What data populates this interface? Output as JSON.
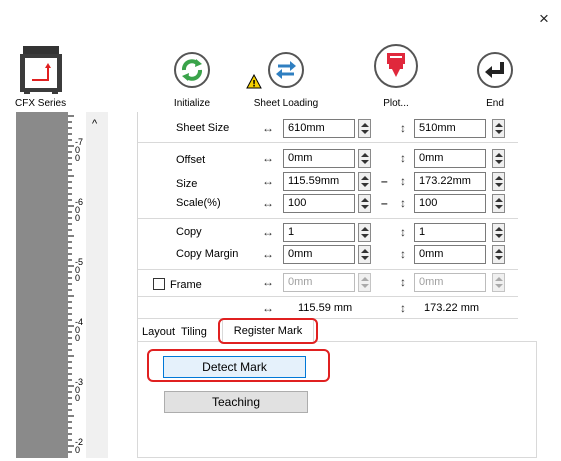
{
  "window": {
    "close_glyph": "×"
  },
  "logo": {
    "label": "CFX Series"
  },
  "toolbar": [
    {
      "label": "Initialize",
      "icon": "refresh-icon"
    },
    {
      "label": "Sheet Loading",
      "icon": "swap-arrows-icon",
      "warning": "!"
    },
    {
      "label": "Plot...",
      "icon": "plotter-cutter-icon"
    },
    {
      "label": "End",
      "icon": "return-arrow-icon"
    }
  ],
  "ruler": {
    "scroll_up": "^",
    "labels": [
      "-7\n0\n0",
      "-6\n0\n0",
      "-5\n0\n0",
      "-4\n0\n0",
      "-3\n0\n0",
      "-2\n0"
    ]
  },
  "glyphs": {
    "horizontal": "↔",
    "vertical": "↕",
    "dash": "–"
  },
  "form": {
    "sheet_size": {
      "label": "Sheet Size",
      "w": "610mm",
      "h": "510mm"
    },
    "offset": {
      "label": "Offset",
      "x": "0mm",
      "y": "0mm"
    },
    "size": {
      "label": "Size",
      "w": "115.59mm",
      "h": "173.22mm"
    },
    "scale": {
      "label": "Scale(%)",
      "x": "100",
      "y": "100"
    },
    "copy": {
      "label": "Copy",
      "x": "1",
      "y": "1"
    },
    "copy_margin": {
      "label": "Copy Margin",
      "x": "0mm",
      "y": "0mm"
    },
    "frame": {
      "label": "Frame",
      "checked": false,
      "x": "0mm",
      "y": "0mm"
    },
    "totals": {
      "w": "115.59 mm",
      "h": "173.22 mm"
    }
  },
  "tabs": [
    {
      "label": "Layout",
      "active": false
    },
    {
      "label": "Tiling",
      "active": false
    },
    {
      "label": "Register Mark",
      "active": true
    }
  ],
  "register_mark": {
    "detect_mark": "Detect Mark",
    "teaching": "Teaching"
  },
  "colors": {
    "initialize": "#3aa34a",
    "sheet_loading": "#2f7fc1",
    "plot": "#e0283c",
    "end": "#222222",
    "highlight": "#e02020"
  }
}
